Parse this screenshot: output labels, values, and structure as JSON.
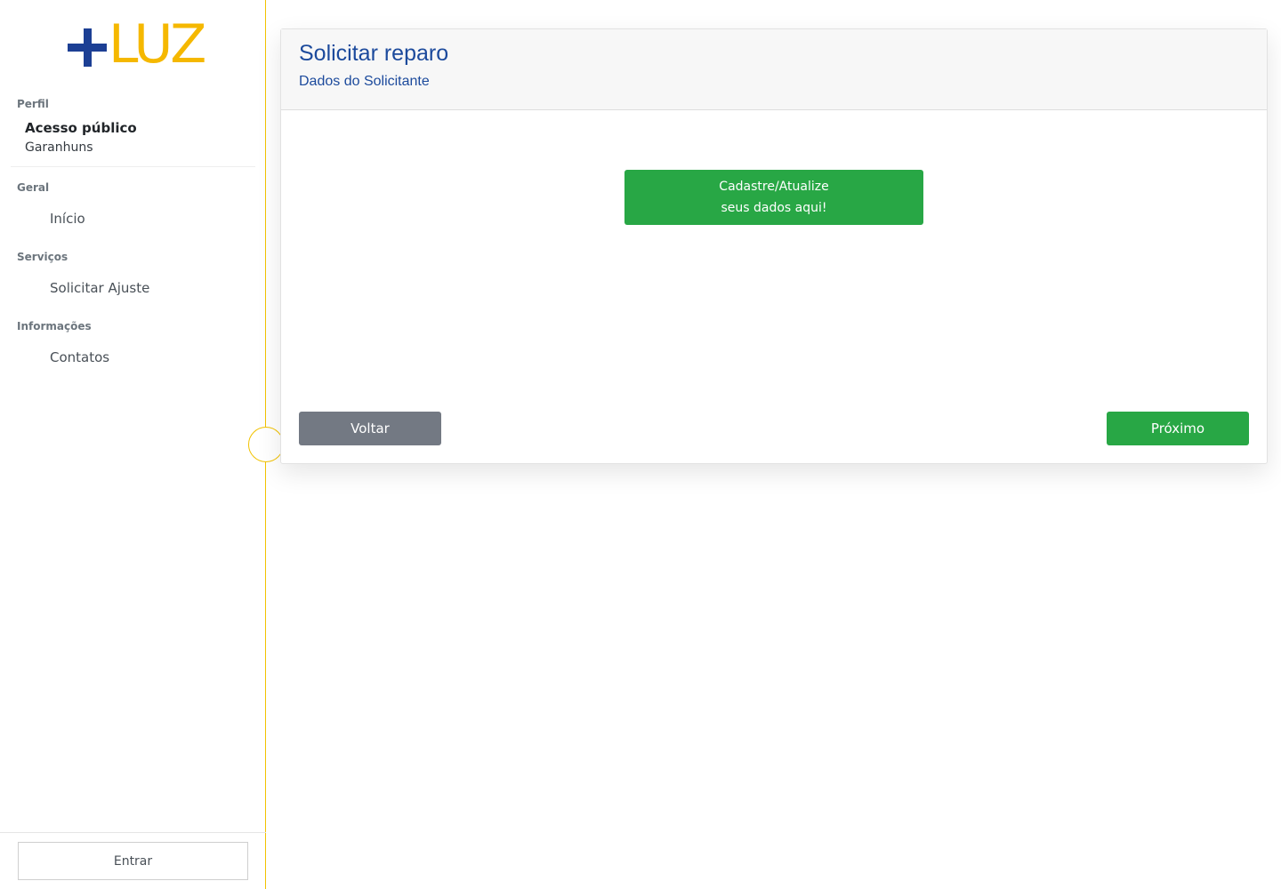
{
  "logo": {
    "text": "LUZ",
    "plus_color": "#1c3f94",
    "text_color": "#f5b800"
  },
  "sidebar": {
    "profile": {
      "section_label": "Perfil",
      "name": "Acesso público",
      "city": "Garanhuns"
    },
    "sections": [
      {
        "label": "Geral",
        "items": [
          {
            "label": "Início"
          }
        ]
      },
      {
        "label": "Serviços",
        "items": [
          {
            "label": "Solicitar Ajuste"
          }
        ]
      },
      {
        "label": "Informações",
        "items": [
          {
            "label": "Contatos"
          }
        ]
      }
    ],
    "login_label": "Entrar"
  },
  "card": {
    "title": "Solicitar reparo",
    "subtitle": "Dados do Solicitante",
    "register_button": {
      "line1": "Cadastre/Atualize",
      "line2": "seus dados aqui!"
    },
    "back_label": "Voltar",
    "next_label": "Próximo"
  },
  "colors": {
    "accent_yellow": "#f2c200",
    "primary_blue": "#1c4a9c",
    "success_green": "#28a745",
    "secondary_gray": "#737983"
  }
}
